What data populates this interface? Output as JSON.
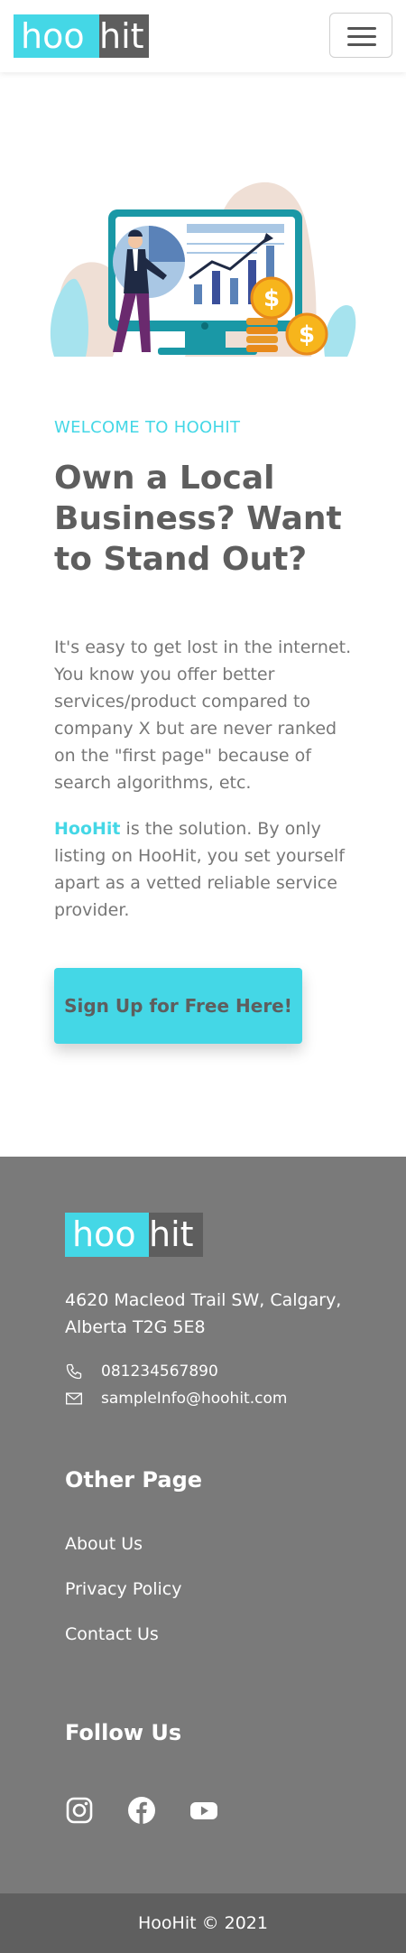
{
  "header": {
    "logo_part1": "hoo",
    "logo_part2": "hit",
    "menu_label": "Toggle navigation"
  },
  "main": {
    "eyebrow": "WELCOME TO HOOHIT",
    "headline": "Own a Local Business? Want to Stand Out?",
    "paragraph1": "It's easy to get lost in the internet. You know you offer better services/product compared to company X but are never ranked on the \"first page\" because of search algorithms, etc.",
    "paragraph2_brand": "HooHit",
    "paragraph2_rest": " is the solution. By only listing on HooHit, you set yourself apart as a vetted reliable service provider.",
    "cta_label": "Sign Up for Free Here!"
  },
  "footer": {
    "logo_part1": "hoo",
    "logo_part2": "hit",
    "address": "4620 Macleod Trail SW, Calgary, Alberta T2G 5E8",
    "phone": "081234567890",
    "email": "sampleInfo@hoohit.com",
    "other_page_title": "Other Page",
    "links": [
      "About Us",
      "Privacy Policy",
      "Contact Us"
    ],
    "follow_title": "Follow Us",
    "social_icons": [
      "instagram-icon",
      "facebook-icon",
      "youtube-icon"
    ],
    "copyright": "HooHit © 2021"
  },
  "colors": {
    "accent": "#44d7e6",
    "dark_gray": "#5e5e5e",
    "footer_bg": "#7a7a7a",
    "bottom_bar_bg": "#5f5f5f"
  }
}
